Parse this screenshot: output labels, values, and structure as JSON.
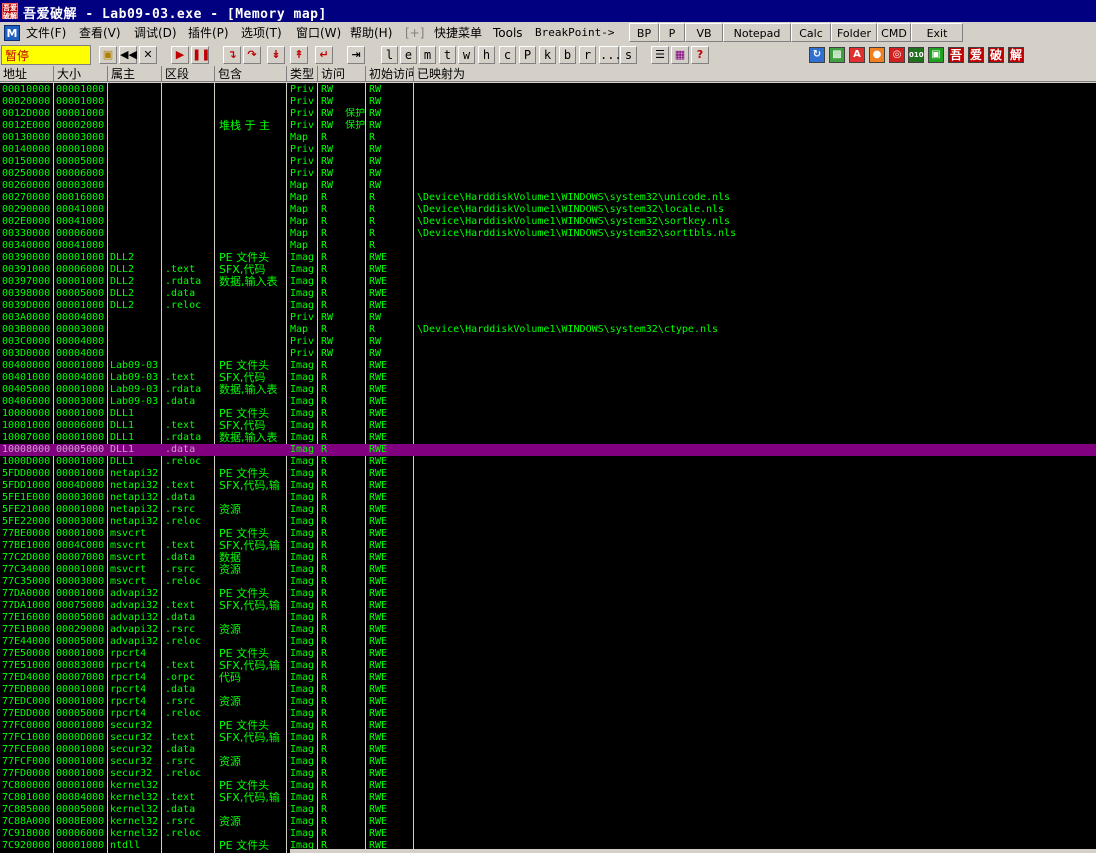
{
  "window": {
    "logo_text": "吾爱破解",
    "title": "吾爱破解 - Lab09-03.exe - [Memory map]"
  },
  "menu": {
    "app_icon": "M",
    "items": [
      "文件(F)",
      "查看(V)",
      "调试(D)",
      "插件(P)",
      "选项(T)",
      "窗口(W)",
      "帮助(H)",
      "[+]",
      "快捷菜单",
      "Tools",
      "BreakPoint->"
    ],
    "buttons": [
      "BP",
      "P",
      "VB",
      "Notepad",
      "Calc",
      "Folder",
      "CMD",
      "Exit"
    ]
  },
  "toolbar": {
    "status": "暂停",
    "letters": [
      "l",
      "e",
      "m",
      "t",
      "w",
      "h",
      "c",
      "P",
      "k",
      "b",
      "r",
      "...",
      "s"
    ],
    "right_icons": [
      "吾",
      "爱",
      "破",
      "解"
    ]
  },
  "columns": [
    "地址",
    "大小",
    "属主",
    "区段",
    "包含",
    "类型",
    "访问",
    "初始访问",
    "已映射为"
  ],
  "rows": [
    {
      "addr": "00010000",
      "size": "00001000",
      "owner": "",
      "section": "",
      "contains": "",
      "type": "Priv",
      "access": "RW",
      "init": "RW",
      "mapped": ""
    },
    {
      "addr": "00020000",
      "size": "00001000",
      "owner": "",
      "section": "",
      "contains": "",
      "type": "Priv",
      "access": "RW",
      "init": "RW",
      "mapped": ""
    },
    {
      "addr": "0012D000",
      "size": "00001000",
      "owner": "",
      "section": "",
      "contains": "",
      "type": "Priv",
      "access": "RW  保护",
      "init": "RW",
      "mapped": ""
    },
    {
      "addr": "0012E000",
      "size": "00002000",
      "owner": "",
      "section": "",
      "contains": "堆栈 于 主",
      "type": "Priv",
      "access": "RW  保护",
      "init": "RW",
      "mapped": ""
    },
    {
      "addr": "00130000",
      "size": "00003000",
      "owner": "",
      "section": "",
      "contains": "",
      "type": "Map",
      "access": "R",
      "init": "R",
      "mapped": ""
    },
    {
      "addr": "00140000",
      "size": "00001000",
      "owner": "",
      "section": "",
      "contains": "",
      "type": "Priv",
      "access": "RW",
      "init": "RW",
      "mapped": ""
    },
    {
      "addr": "00150000",
      "size": "00005000",
      "owner": "",
      "section": "",
      "contains": "",
      "type": "Priv",
      "access": "RW",
      "init": "RW",
      "mapped": ""
    },
    {
      "addr": "00250000",
      "size": "00006000",
      "owner": "",
      "section": "",
      "contains": "",
      "type": "Priv",
      "access": "RW",
      "init": "RW",
      "mapped": ""
    },
    {
      "addr": "00260000",
      "size": "00003000",
      "owner": "",
      "section": "",
      "contains": "",
      "type": "Map",
      "access": "RW",
      "init": "RW",
      "mapped": ""
    },
    {
      "addr": "00270000",
      "size": "00016000",
      "owner": "",
      "section": "",
      "contains": "",
      "type": "Map",
      "access": "R",
      "init": "R",
      "mapped": "\\Device\\HarddiskVolume1\\WINDOWS\\system32\\unicode.nls"
    },
    {
      "addr": "00290000",
      "size": "00041000",
      "owner": "",
      "section": "",
      "contains": "",
      "type": "Map",
      "access": "R",
      "init": "R",
      "mapped": "\\Device\\HarddiskVolume1\\WINDOWS\\system32\\locale.nls"
    },
    {
      "addr": "002E0000",
      "size": "00041000",
      "owner": "",
      "section": "",
      "contains": "",
      "type": "Map",
      "access": "R",
      "init": "R",
      "mapped": "\\Device\\HarddiskVolume1\\WINDOWS\\system32\\sortkey.nls"
    },
    {
      "addr": "00330000",
      "size": "00006000",
      "owner": "",
      "section": "",
      "contains": "",
      "type": "Map",
      "access": "R",
      "init": "R",
      "mapped": "\\Device\\HarddiskVolume1\\WINDOWS\\system32\\sorttbls.nls"
    },
    {
      "addr": "00340000",
      "size": "00041000",
      "owner": "",
      "section": "",
      "contains": "",
      "type": "Map",
      "access": "R",
      "init": "R",
      "mapped": ""
    },
    {
      "addr": "00390000",
      "size": "00001000",
      "owner": "DLL2",
      "section": "",
      "contains": "PE 文件头",
      "type": "Imag",
      "access": "R",
      "init": "RWE",
      "mapped": ""
    },
    {
      "addr": "00391000",
      "size": "00006000",
      "owner": "DLL2",
      "section": ".text",
      "contains": "SFX,代码",
      "type": "Imag",
      "access": "R",
      "init": "RWE",
      "mapped": ""
    },
    {
      "addr": "00397000",
      "size": "00001000",
      "owner": "DLL2",
      "section": ".rdata",
      "contains": "数据,输入表",
      "type": "Imag",
      "access": "R",
      "init": "RWE",
      "mapped": ""
    },
    {
      "addr": "00398000",
      "size": "00005000",
      "owner": "DLL2",
      "section": ".data",
      "contains": "",
      "type": "Imag",
      "access": "R",
      "init": "RWE",
      "mapped": ""
    },
    {
      "addr": "0039D000",
      "size": "00001000",
      "owner": "DLL2",
      "section": ".reloc",
      "contains": "",
      "type": "Imag",
      "access": "R",
      "init": "RWE",
      "mapped": ""
    },
    {
      "addr": "003A0000",
      "size": "00004000",
      "owner": "",
      "section": "",
      "contains": "",
      "type": "Priv",
      "access": "RW",
      "init": "RW",
      "mapped": ""
    },
    {
      "addr": "003B0000",
      "size": "00003000",
      "owner": "",
      "section": "",
      "contains": "",
      "type": "Map",
      "access": "R",
      "init": "R",
      "mapped": "\\Device\\HarddiskVolume1\\WINDOWS\\system32\\ctype.nls"
    },
    {
      "addr": "003C0000",
      "size": "00004000",
      "owner": "",
      "section": "",
      "contains": "",
      "type": "Priv",
      "access": "RW",
      "init": "RW",
      "mapped": ""
    },
    {
      "addr": "003D0000",
      "size": "00004000",
      "owner": "",
      "section": "",
      "contains": "",
      "type": "Priv",
      "access": "RW",
      "init": "RW",
      "mapped": ""
    },
    {
      "addr": "00400000",
      "size": "00001000",
      "owner": "Lab09-03",
      "section": "",
      "contains": "PE 文件头",
      "type": "Imag",
      "access": "R",
      "init": "RWE",
      "mapped": ""
    },
    {
      "addr": "00401000",
      "size": "00004000",
      "owner": "Lab09-03",
      "section": ".text",
      "contains": "SFX,代码",
      "type": "Imag",
      "access": "R",
      "init": "RWE",
      "mapped": ""
    },
    {
      "addr": "00405000",
      "size": "00001000",
      "owner": "Lab09-03",
      "section": ".rdata",
      "contains": "数据,输入表",
      "type": "Imag",
      "access": "R",
      "init": "RWE",
      "mapped": ""
    },
    {
      "addr": "00406000",
      "size": "00003000",
      "owner": "Lab09-03",
      "section": ".data",
      "contains": "",
      "type": "Imag",
      "access": "R",
      "init": "RWE",
      "mapped": ""
    },
    {
      "addr": "10000000",
      "size": "00001000",
      "owner": "DLL1",
      "section": "",
      "contains": "PE 文件头",
      "type": "Imag",
      "access": "R",
      "init": "RWE",
      "mapped": ""
    },
    {
      "addr": "10001000",
      "size": "00006000",
      "owner": "DLL1",
      "section": ".text",
      "contains": "SFX,代码",
      "type": "Imag",
      "access": "R",
      "init": "RWE",
      "mapped": ""
    },
    {
      "addr": "10007000",
      "size": "00001000",
      "owner": "DLL1",
      "section": ".rdata",
      "contains": "数据,输入表",
      "type": "Imag",
      "access": "R",
      "init": "RWE",
      "mapped": ""
    },
    {
      "addr": "10008000",
      "size": "00005000",
      "owner": "DLL1",
      "section": ".data",
      "contains": "",
      "type": "Imag",
      "access": "R",
      "init": "RWE",
      "mapped": "",
      "selected": true
    },
    {
      "addr": "1000D000",
      "size": "00001000",
      "owner": "DLL1",
      "section": ".reloc",
      "contains": "",
      "type": "Imag",
      "access": "R",
      "init": "RWE",
      "mapped": ""
    },
    {
      "addr": "5FDD0000",
      "size": "00001000",
      "owner": "netapi32",
      "section": "",
      "contains": "PE 文件头",
      "type": "Imag",
      "access": "R",
      "init": "RWE",
      "mapped": ""
    },
    {
      "addr": "5FDD1000",
      "size": "0004D000",
      "owner": "netapi32",
      "section": ".text",
      "contains": "SFX,代码,输",
      "type": "Imag",
      "access": "R",
      "init": "RWE",
      "mapped": ""
    },
    {
      "addr": "5FE1E000",
      "size": "00003000",
      "owner": "netapi32",
      "section": ".data",
      "contains": "",
      "type": "Imag",
      "access": "R",
      "init": "RWE",
      "mapped": ""
    },
    {
      "addr": "5FE21000",
      "size": "00001000",
      "owner": "netapi32",
      "section": ".rsrc",
      "contains": "资源",
      "type": "Imag",
      "access": "R",
      "init": "RWE",
      "mapped": ""
    },
    {
      "addr": "5FE22000",
      "size": "00003000",
      "owner": "netapi32",
      "section": ".reloc",
      "contains": "",
      "type": "Imag",
      "access": "R",
      "init": "RWE",
      "mapped": ""
    },
    {
      "addr": "77BE0000",
      "size": "00001000",
      "owner": "msvcrt",
      "section": "",
      "contains": "PE 文件头",
      "type": "Imag",
      "access": "R",
      "init": "RWE",
      "mapped": ""
    },
    {
      "addr": "77BE1000",
      "size": "0004C000",
      "owner": "msvcrt",
      "section": ".text",
      "contains": "SFX,代码,输",
      "type": "Imag",
      "access": "R",
      "init": "RWE",
      "mapped": ""
    },
    {
      "addr": "77C2D000",
      "size": "00007000",
      "owner": "msvcrt",
      "section": ".data",
      "contains": "数据",
      "type": "Imag",
      "access": "R",
      "init": "RWE",
      "mapped": ""
    },
    {
      "addr": "77C34000",
      "size": "00001000",
      "owner": "msvcrt",
      "section": ".rsrc",
      "contains": "资源",
      "type": "Imag",
      "access": "R",
      "init": "RWE",
      "mapped": ""
    },
    {
      "addr": "77C35000",
      "size": "00003000",
      "owner": "msvcrt",
      "section": ".reloc",
      "contains": "",
      "type": "Imag",
      "access": "R",
      "init": "RWE",
      "mapped": ""
    },
    {
      "addr": "77DA0000",
      "size": "00001000",
      "owner": "advapi32",
      "section": "",
      "contains": "PE 文件头",
      "type": "Imag",
      "access": "R",
      "init": "RWE",
      "mapped": ""
    },
    {
      "addr": "77DA1000",
      "size": "00075000",
      "owner": "advapi32",
      "section": ".text",
      "contains": "SFX,代码,输",
      "type": "Imag",
      "access": "R",
      "init": "RWE",
      "mapped": ""
    },
    {
      "addr": "77E16000",
      "size": "00005000",
      "owner": "advapi32",
      "section": ".data",
      "contains": "",
      "type": "Imag",
      "access": "R",
      "init": "RWE",
      "mapped": ""
    },
    {
      "addr": "77E1B000",
      "size": "00029000",
      "owner": "advapi32",
      "section": ".rsrc",
      "contains": "资源",
      "type": "Imag",
      "access": "R",
      "init": "RWE",
      "mapped": ""
    },
    {
      "addr": "77E44000",
      "size": "00005000",
      "owner": "advapi32",
      "section": ".reloc",
      "contains": "",
      "type": "Imag",
      "access": "R",
      "init": "RWE",
      "mapped": ""
    },
    {
      "addr": "77E50000",
      "size": "00001000",
      "owner": "rpcrt4",
      "section": "",
      "contains": "PE 文件头",
      "type": "Imag",
      "access": "R",
      "init": "RWE",
      "mapped": ""
    },
    {
      "addr": "77E51000",
      "size": "00083000",
      "owner": "rpcrt4",
      "section": ".text",
      "contains": "SFX,代码,输",
      "type": "Imag",
      "access": "R",
      "init": "RWE",
      "mapped": ""
    },
    {
      "addr": "77ED4000",
      "size": "00007000",
      "owner": "rpcrt4",
      "section": ".orpc",
      "contains": "代码",
      "type": "Imag",
      "access": "R",
      "init": "RWE",
      "mapped": ""
    },
    {
      "addr": "77EDB000",
      "size": "00001000",
      "owner": "rpcrt4",
      "section": ".data",
      "contains": "",
      "type": "Imag",
      "access": "R",
      "init": "RWE",
      "mapped": ""
    },
    {
      "addr": "77EDC000",
      "size": "00001000",
      "owner": "rpcrt4",
      "section": ".rsrc",
      "contains": "资源",
      "type": "Imag",
      "access": "R",
      "init": "RWE",
      "mapped": ""
    },
    {
      "addr": "77EDD000",
      "size": "00005000",
      "owner": "rpcrt4",
      "section": ".reloc",
      "contains": "",
      "type": "Imag",
      "access": "R",
      "init": "RWE",
      "mapped": ""
    },
    {
      "addr": "77FC0000",
      "size": "00001000",
      "owner": "secur32",
      "section": "",
      "contains": "PE 文件头",
      "type": "Imag",
      "access": "R",
      "init": "RWE",
      "mapped": ""
    },
    {
      "addr": "77FC1000",
      "size": "0000D000",
      "owner": "secur32",
      "section": ".text",
      "contains": "SFX,代码,输",
      "type": "Imag",
      "access": "R",
      "init": "RWE",
      "mapped": ""
    },
    {
      "addr": "77FCE000",
      "size": "00001000",
      "owner": "secur32",
      "section": ".data",
      "contains": "",
      "type": "Imag",
      "access": "R",
      "init": "RWE",
      "mapped": ""
    },
    {
      "addr": "77FCF000",
      "size": "00001000",
      "owner": "secur32",
      "section": ".rsrc",
      "contains": "资源",
      "type": "Imag",
      "access": "R",
      "init": "RWE",
      "mapped": ""
    },
    {
      "addr": "77FD0000",
      "size": "00001000",
      "owner": "secur32",
      "section": ".reloc",
      "contains": "",
      "type": "Imag",
      "access": "R",
      "init": "RWE",
      "mapped": ""
    },
    {
      "addr": "7C800000",
      "size": "00001000",
      "owner": "kernel32",
      "section": "",
      "contains": "PE 文件头",
      "type": "Imag",
      "access": "R",
      "init": "RWE",
      "mapped": ""
    },
    {
      "addr": "7C801000",
      "size": "00084000",
      "owner": "kernel32",
      "section": ".text",
      "contains": "SFX,代码,输",
      "type": "Imag",
      "access": "R",
      "init": "RWE",
      "mapped": ""
    },
    {
      "addr": "7C885000",
      "size": "00005000",
      "owner": "kernel32",
      "section": ".data",
      "contains": "",
      "type": "Imag",
      "access": "R",
      "init": "RWE",
      "mapped": ""
    },
    {
      "addr": "7C88A000",
      "size": "0008E000",
      "owner": "kernel32",
      "section": ".rsrc",
      "contains": "资源",
      "type": "Imag",
      "access": "R",
      "init": "RWE",
      "mapped": ""
    },
    {
      "addr": "7C918000",
      "size": "00006000",
      "owner": "kernel32",
      "section": ".reloc",
      "contains": "",
      "type": "Imag",
      "access": "R",
      "init": "RWE",
      "mapped": ""
    },
    {
      "addr": "7C920000",
      "size": "00001000",
      "owner": "ntdll",
      "section": "",
      "contains": "PE 文件头",
      "type": "Imag",
      "access": "R",
      "init": "RWE",
      "mapped": ""
    }
  ]
}
